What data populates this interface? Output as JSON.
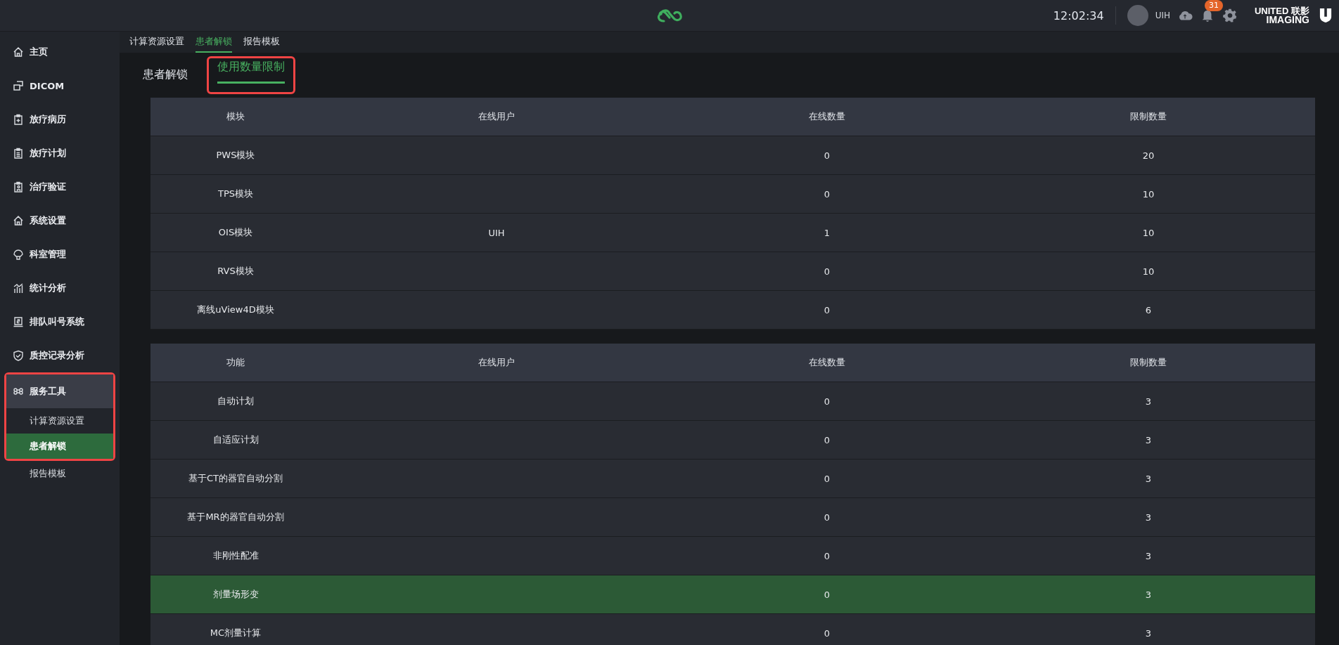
{
  "topbar": {
    "time": "12:02:34",
    "user": "UIH",
    "notification_count": "31",
    "brand_top": "UNITED",
    "brand_cn": "联影",
    "brand_bottom": "IMAGING"
  },
  "sidebar": {
    "items": [
      {
        "label": "主页",
        "selected": false
      },
      {
        "label": "DICOM",
        "selected": false
      },
      {
        "label": "放疗病历",
        "selected": false
      },
      {
        "label": "放疗计划",
        "selected": false
      },
      {
        "label": "治疗验证",
        "selected": false
      },
      {
        "label": "系统设置",
        "selected": false
      },
      {
        "label": "科室管理",
        "selected": false
      },
      {
        "label": "统计分析",
        "selected": false
      },
      {
        "label": "排队叫号系统",
        "selected": false
      },
      {
        "label": "质控记录分析",
        "selected": false
      },
      {
        "label": "服务工具",
        "selected": true,
        "highlighted": true,
        "children": [
          {
            "label": "计算资源设置",
            "selected": false,
            "highlighted": true
          },
          {
            "label": "患者解锁",
            "selected": true,
            "highlighted": true
          },
          {
            "label": "报告模板",
            "selected": false,
            "highlighted": false
          }
        ]
      }
    ]
  },
  "sub_tabs": [
    {
      "label": "计算资源设置",
      "selected": false
    },
    {
      "label": "患者解锁",
      "selected": true
    },
    {
      "label": "报告模板",
      "selected": false
    }
  ],
  "page_tabs": [
    {
      "label": "患者解锁",
      "selected": false,
      "highlighted": false
    },
    {
      "label": "使用数量限制",
      "selected": true,
      "highlighted": true
    }
  ],
  "tables": [
    {
      "columns": [
        "模块",
        "在线用户",
        "在线数量",
        "限制数量"
      ],
      "rows": [
        {
          "cells": [
            "PWS模块",
            "",
            "0",
            "20"
          ],
          "selected": false
        },
        {
          "cells": [
            "TPS模块",
            "",
            "0",
            "10"
          ],
          "selected": false
        },
        {
          "cells": [
            "OIS模块",
            "UIH",
            "1",
            "10"
          ],
          "selected": false
        },
        {
          "cells": [
            "RVS模块",
            "",
            "0",
            "10"
          ],
          "selected": false
        },
        {
          "cells": [
            "离线uView4D模块",
            "",
            "0",
            "6"
          ],
          "selected": false
        }
      ]
    },
    {
      "columns": [
        "功能",
        "在线用户",
        "在线数量",
        "限制数量"
      ],
      "rows": [
        {
          "cells": [
            "自动计划",
            "",
            "0",
            "3"
          ],
          "selected": false
        },
        {
          "cells": [
            "自适应计划",
            "",
            "0",
            "3"
          ],
          "selected": false
        },
        {
          "cells": [
            "基于CT的器官自动分割",
            "",
            "0",
            "3"
          ],
          "selected": false
        },
        {
          "cells": [
            "基于MR的器官自动分割",
            "",
            "0",
            "3"
          ],
          "selected": false
        },
        {
          "cells": [
            "非刚性配准",
            "",
            "0",
            "3"
          ],
          "selected": false
        },
        {
          "cells": [
            "剂量场形变",
            "",
            "0",
            "3"
          ],
          "selected": true
        },
        {
          "cells": [
            "MC剂量计算",
            "",
            "0",
            "3"
          ],
          "selected": false
        }
      ]
    }
  ]
}
